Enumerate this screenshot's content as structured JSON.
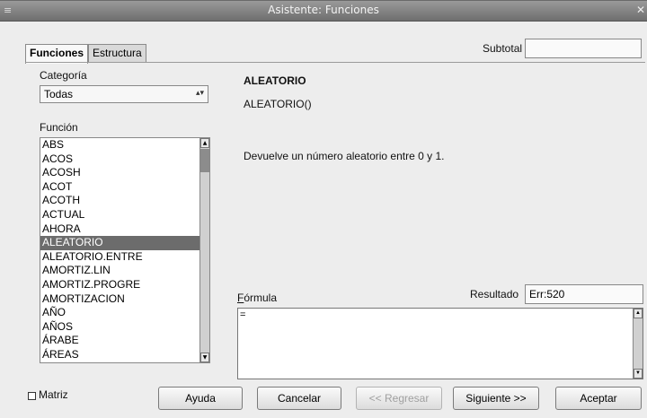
{
  "window": {
    "title": "Asistente: Funciones"
  },
  "tabs": [
    {
      "label": "Funciones",
      "active": true
    },
    {
      "label": "Estructura",
      "active": false
    }
  ],
  "category": {
    "label": "Categoría",
    "selected": "Todas"
  },
  "function_list": {
    "label": "Función",
    "items": [
      "ABS",
      "ACOS",
      "ACOSH",
      "ACOT",
      "ACOTH",
      "ACTUAL",
      "AHORA",
      "ALEATORIO",
      "ALEATORIO.ENTRE",
      "AMORTIZ.LIN",
      "AMORTIZ.PROGRE",
      "AMORTIZACION",
      "AÑO",
      "AÑOS",
      "ÁRABE",
      "ÁREAS"
    ],
    "selected": "ALEATORIO"
  },
  "details": {
    "name": "ALEATORIO",
    "syntax": "ALEATORIO()",
    "description": "Devuelve un número aleatorio entre 0 y 1."
  },
  "subtotal": {
    "label": "Subtotal",
    "value": ""
  },
  "formula": {
    "label": "Fórmula",
    "value": "="
  },
  "result": {
    "label": "Resultado",
    "value": "Err:520"
  },
  "matrix": {
    "label": "Matriz",
    "checked": false
  },
  "buttons": {
    "help": "Ayuda",
    "cancel": "Cancelar",
    "back": "<< Regresar",
    "next": "Siguiente >>",
    "ok": "Aceptar"
  }
}
